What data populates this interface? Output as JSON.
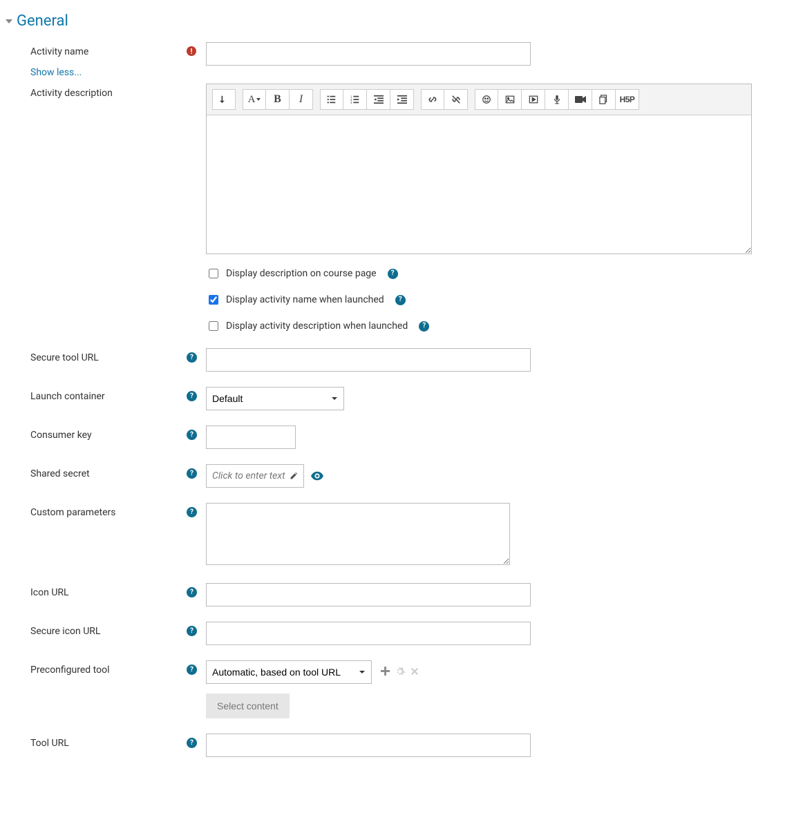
{
  "section": {
    "title": "General"
  },
  "labels": {
    "activity_name": "Activity name",
    "show_less": "Show less...",
    "activity_description": "Activity description",
    "secure_tool_url": "Secure tool URL",
    "launch_container": "Launch container",
    "consumer_key": "Consumer key",
    "shared_secret": "Shared secret",
    "custom_parameters": "Custom parameters",
    "icon_url": "Icon URL",
    "secure_icon_url": "Secure icon URL",
    "preconfigured_tool": "Preconfigured tool",
    "select_content": "Select content",
    "tool_url": "Tool URL"
  },
  "checkboxes": {
    "display_description_on_course_page": {
      "label": "Display description on course page",
      "checked": false
    },
    "display_activity_name_when_launched": {
      "label": "Display activity name when launched",
      "checked": true
    },
    "display_activity_description_when_launched": {
      "label": "Display activity description when launched",
      "checked": false
    }
  },
  "values": {
    "activity_name": "",
    "secure_tool_url": "",
    "launch_container": "Default",
    "consumer_key": "",
    "shared_secret_placeholder": "Click to enter text",
    "custom_parameters": "",
    "icon_url": "",
    "secure_icon_url": "",
    "preconfigured_tool": "Automatic, based on tool URL",
    "tool_url": ""
  },
  "editor_toolbar": {
    "expand": "expand-toolbar",
    "font": "A",
    "bold": "B",
    "italic": "I",
    "ul": "unordered-list",
    "ol": "ordered-list",
    "outdent": "outdent",
    "indent": "indent",
    "link": "link",
    "unlink": "unlink",
    "emoji": "emoji",
    "image": "image",
    "media": "media",
    "mic": "record-audio",
    "video": "record-video",
    "files": "manage-files",
    "h5p": "H5P"
  }
}
